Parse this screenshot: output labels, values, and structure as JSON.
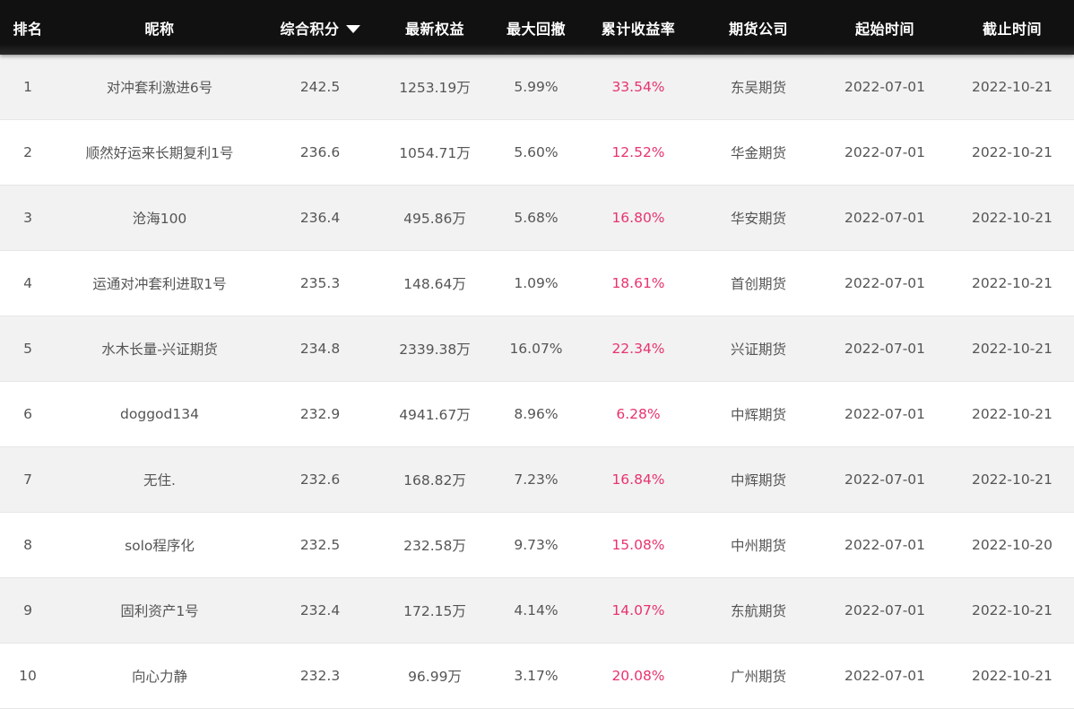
{
  "colors": {
    "header_bg": "#111111",
    "header_text": "#ffffff",
    "row_odd": "#f2f2f2",
    "row_even": "#ffffff",
    "text": "#555555",
    "return_accent": "#e8336d"
  },
  "header": {
    "rank": "排名",
    "name": "昵称",
    "score": "综合积分",
    "score_sort_icon": "caret-down-icon",
    "equity": "最新权益",
    "drawdown": "最大回撤",
    "return": "累计收益率",
    "company": "期货公司",
    "start": "起始时间",
    "end": "截止时间"
  },
  "rows": [
    {
      "rank": "1",
      "name": "对冲套利激进6号",
      "score": "242.5",
      "equity": "1253.19万",
      "drawdown": "5.99%",
      "return": "33.54%",
      "company": "东吴期货",
      "start": "2022-07-01",
      "end": "2022-10-21"
    },
    {
      "rank": "2",
      "name": "顺然好运来长期复利1号",
      "score": "236.6",
      "equity": "1054.71万",
      "drawdown": "5.60%",
      "return": "12.52%",
      "company": "华金期货",
      "start": "2022-07-01",
      "end": "2022-10-21"
    },
    {
      "rank": "3",
      "name": "沧海100",
      "score": "236.4",
      "equity": "495.86万",
      "drawdown": "5.68%",
      "return": "16.80%",
      "company": "华安期货",
      "start": "2022-07-01",
      "end": "2022-10-21"
    },
    {
      "rank": "4",
      "name": "运通对冲套利进取1号",
      "score": "235.3",
      "equity": "148.64万",
      "drawdown": "1.09%",
      "return": "18.61%",
      "company": "首创期货",
      "start": "2022-07-01",
      "end": "2022-10-21"
    },
    {
      "rank": "5",
      "name": "水木长量-兴证期货",
      "score": "234.8",
      "equity": "2339.38万",
      "drawdown": "16.07%",
      "return": "22.34%",
      "company": "兴证期货",
      "start": "2022-07-01",
      "end": "2022-10-21"
    },
    {
      "rank": "6",
      "name": "doggod134",
      "score": "232.9",
      "equity": "4941.67万",
      "drawdown": "8.96%",
      "return": "6.28%",
      "company": "中辉期货",
      "start": "2022-07-01",
      "end": "2022-10-21"
    },
    {
      "rank": "7",
      "name": "无住.",
      "score": "232.6",
      "equity": "168.82万",
      "drawdown": "7.23%",
      "return": "16.84%",
      "company": "中辉期货",
      "start": "2022-07-01",
      "end": "2022-10-21"
    },
    {
      "rank": "8",
      "name": "solo程序化",
      "score": "232.5",
      "equity": "232.58万",
      "drawdown": "9.73%",
      "return": "15.08%",
      "company": "中州期货",
      "start": "2022-07-01",
      "end": "2022-10-20"
    },
    {
      "rank": "9",
      "name": "固利资产1号",
      "score": "232.4",
      "equity": "172.15万",
      "drawdown": "4.14%",
      "return": "14.07%",
      "company": "东航期货",
      "start": "2022-07-01",
      "end": "2022-10-21"
    },
    {
      "rank": "10",
      "name": "向心力静",
      "score": "232.3",
      "equity": "96.99万",
      "drawdown": "3.17%",
      "return": "20.08%",
      "company": "广州期货",
      "start": "2022-07-01",
      "end": "2022-10-21"
    }
  ]
}
